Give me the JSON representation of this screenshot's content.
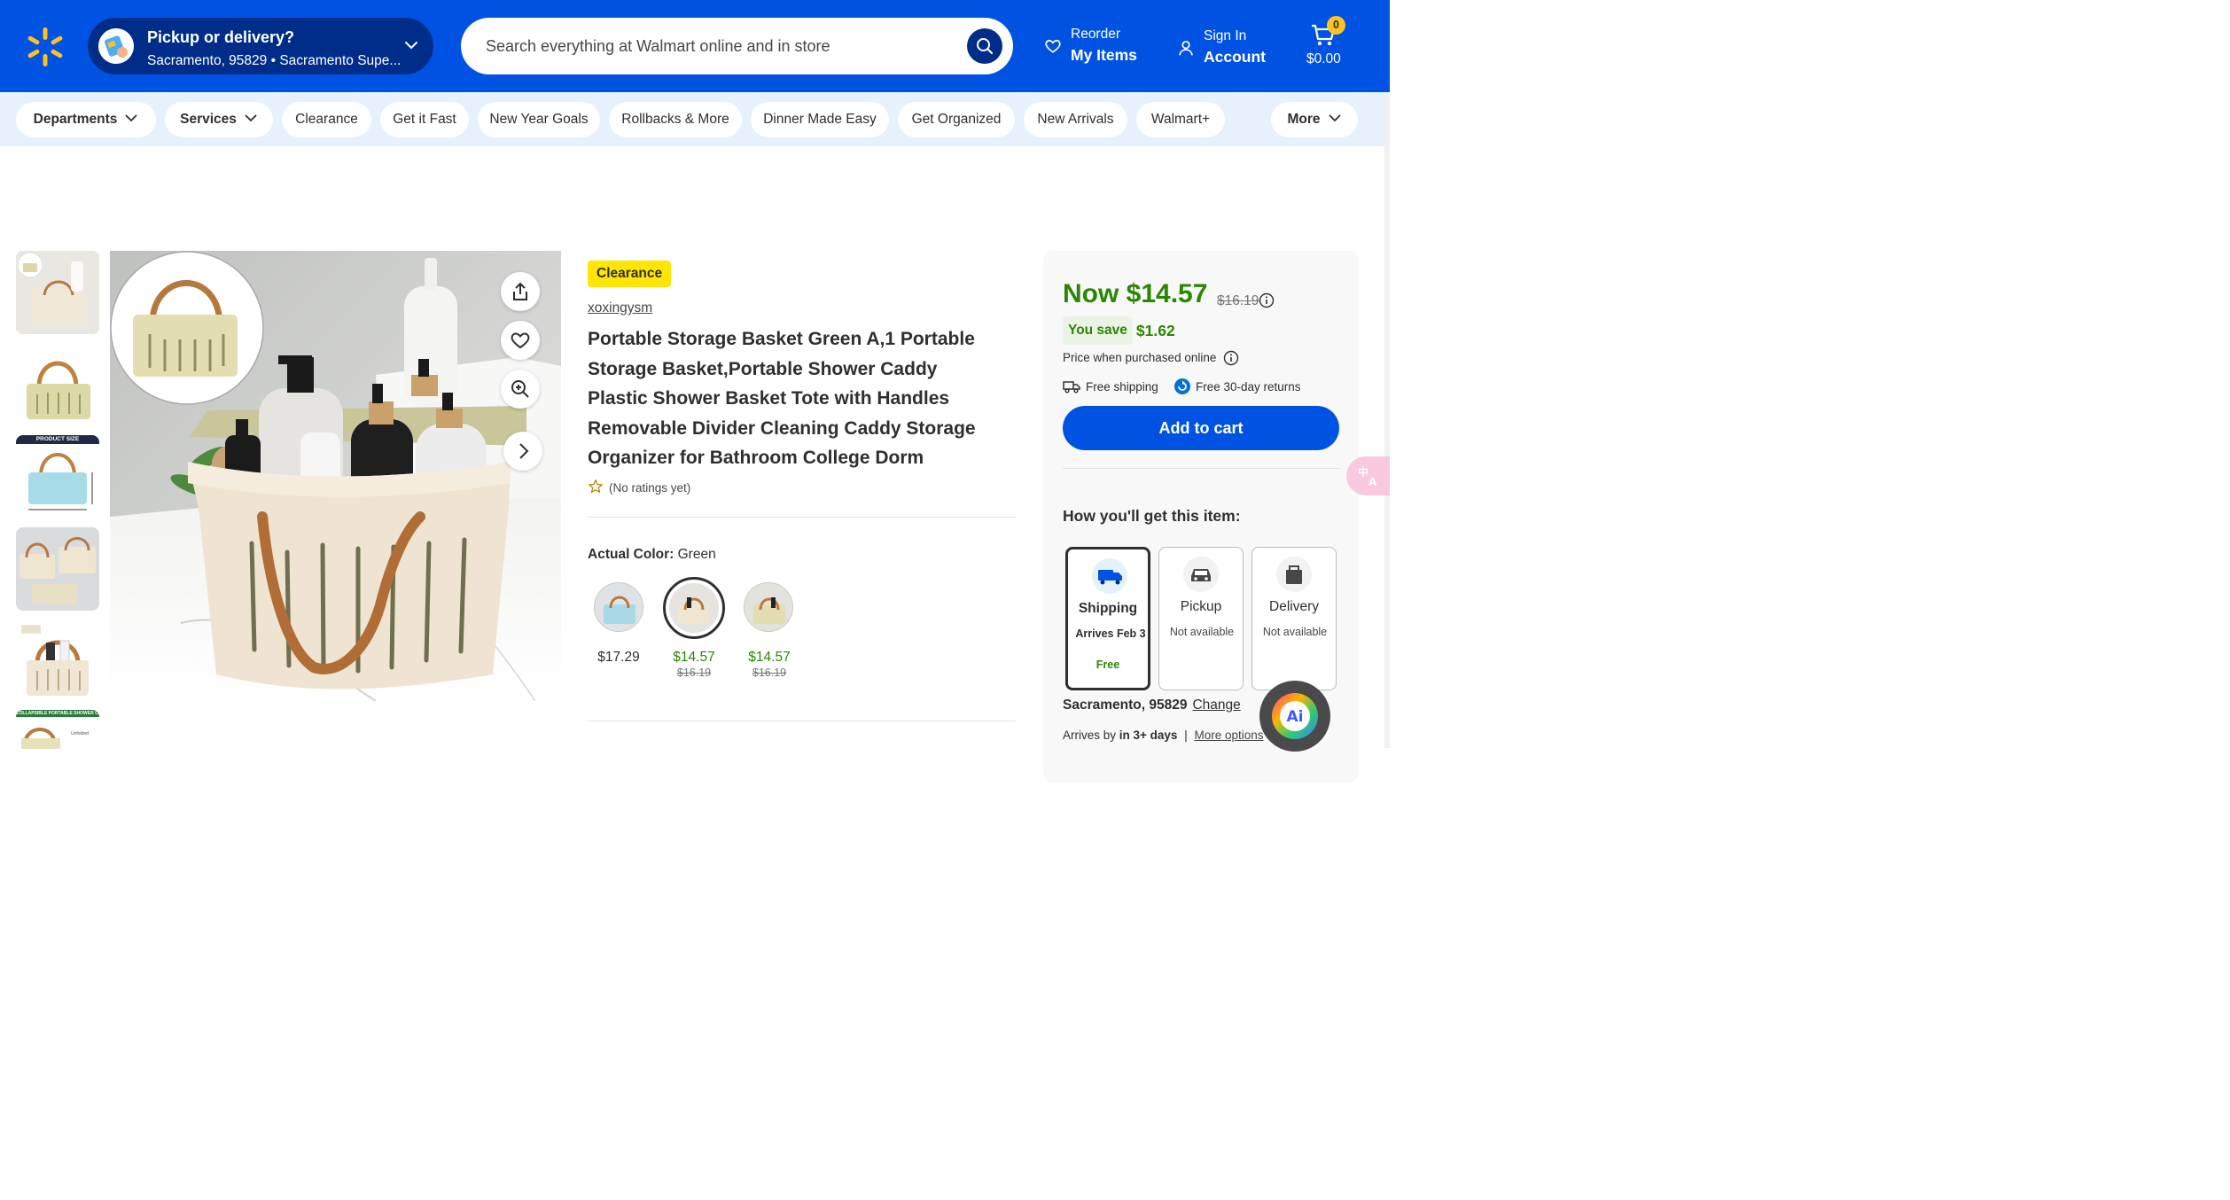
{
  "header": {
    "pickup_title": "Pickup or delivery?",
    "pickup_location": "Sacramento, 95829 • Sacramento Supe...",
    "search_placeholder": "Search everything at Walmart online and in store",
    "reorder_small": "Reorder",
    "reorder_big": "My Items",
    "signin_small": "Sign In",
    "signin_big": "Account",
    "cart_count": "0",
    "cart_total": "$0.00"
  },
  "nav": {
    "departments": "Departments",
    "services": "Services",
    "items": [
      "Clearance",
      "Get it Fast",
      "New Year Goals",
      "Rollbacks & More",
      "Dinner Made Easy",
      "Get Organized",
      "New Arrivals",
      "Walmart+"
    ],
    "more": "More"
  },
  "gallery": {
    "thumb3_label": "PRODUCT SIZE",
    "thumb6_label": "COLLAPSIBLE PORTABLE SHOWER CADDY",
    "thumb6_sub": "Unfolded"
  },
  "product": {
    "badge": "Clearance",
    "brand": "xoxingysm",
    "title": "Portable Storage Basket Green A,1 Portable Storage Basket,Portable Shower Caddy Plastic Shower Basket Tote with Handles Removable Divider Cleaning Caddy Storage Organizer for Bathroom College Dorm",
    "rating_text": "(No ratings yet)",
    "color_label": "Actual Color:",
    "color_value": "Green",
    "swatches": [
      {
        "price": "$17.29",
        "old": ""
      },
      {
        "price": "$14.57",
        "old": "$16.19"
      },
      {
        "price": "$14.57",
        "old": "$16.19"
      }
    ]
  },
  "buybox": {
    "now": "Now $14.57",
    "was": "$16.19",
    "you_save_label": "You save",
    "you_save_value": "$1.62",
    "price_note": "Price when purchased online",
    "free_shipping": "Free shipping",
    "free_returns": "Free 30-day returns",
    "add_to_cart": "Add to cart",
    "how_get": "How you'll get this item:",
    "options": [
      {
        "name": "Shipping",
        "sub": "Arrives Feb 3",
        "extra": "Free"
      },
      {
        "name": "Pickup",
        "sub": "Not available"
      },
      {
        "name": "Delivery",
        "sub": "Not available"
      }
    ],
    "location": "Sacramento, 95829",
    "change": "Change",
    "arrives_prefix": "Arrives by",
    "arrives_value": "in 3+ days",
    "more_options": "More options"
  },
  "colors": {
    "brand_blue": "#0053e2",
    "dark_blue": "#002d8a",
    "spark_yellow": "#ffc220",
    "save_green": "#2a8703",
    "clearance_yellow": "#ffe600"
  },
  "icons": [
    "spark-logo-icon",
    "chevron-down-icon",
    "search-icon",
    "heart-icon",
    "user-icon",
    "cart-icon",
    "share-icon",
    "zoom-in-icon",
    "chevron-right-icon",
    "star-outline-icon",
    "info-icon",
    "truck-icon",
    "returns-icon",
    "translate-icon",
    "ai-assistant-icon"
  ]
}
